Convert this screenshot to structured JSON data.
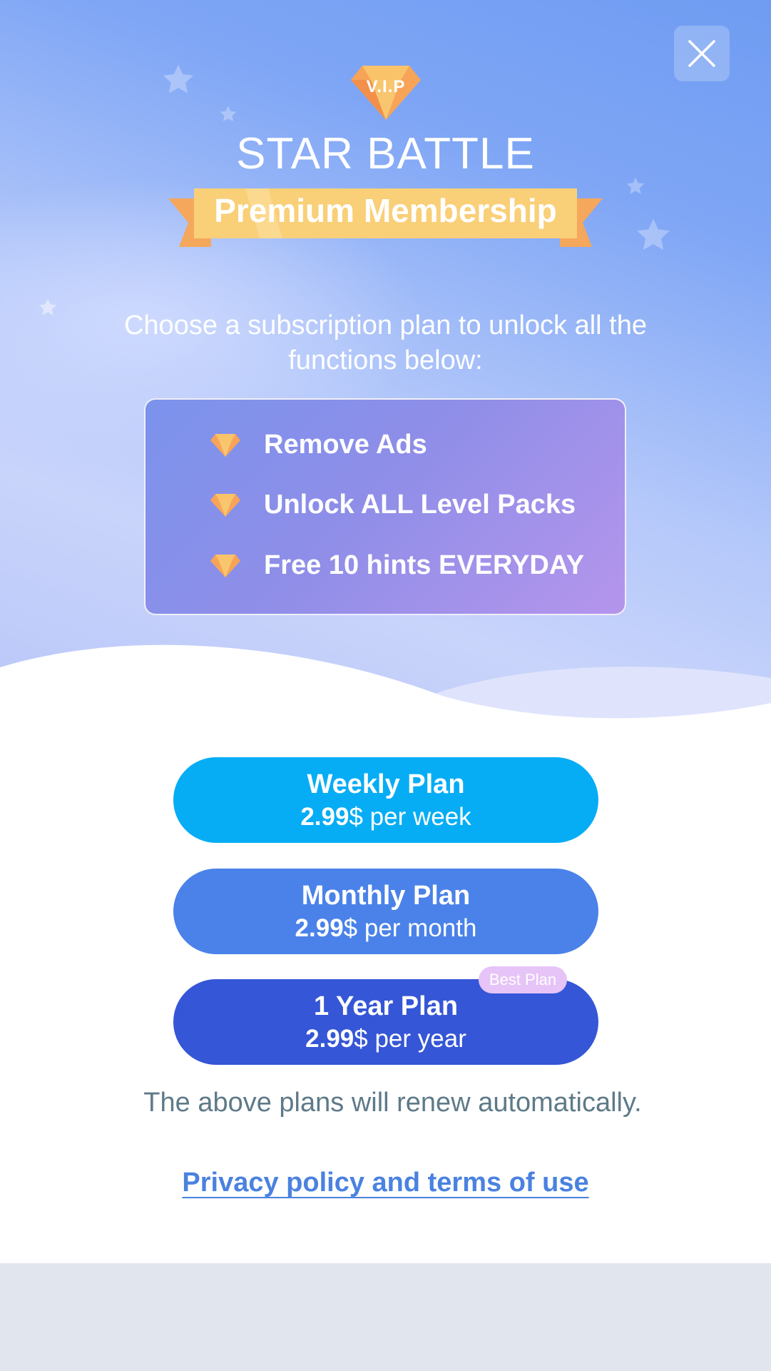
{
  "header": {
    "close_icon": "close-icon",
    "vip_label": "V.I.P",
    "title": "STAR BATTLE",
    "ribbon_label": "Premium Membership"
  },
  "intro": {
    "subtitle": "Choose a subscription plan to unlock all the functions below:"
  },
  "features": [
    {
      "icon": "diamond-icon",
      "label": "Remove Ads"
    },
    {
      "icon": "diamond-icon",
      "label": "Unlock ALL Level Packs"
    },
    {
      "icon": "diamond-icon",
      "label": "Free 10 hints EVERYDAY"
    }
  ],
  "plans": [
    {
      "name": "Weekly Plan",
      "price": "2.99",
      "period": "$ per week",
      "color": "#06adf5"
    },
    {
      "name": "Monthly Plan",
      "price": "2.99",
      "period": "$ per month",
      "color": "#4a82e9"
    },
    {
      "name": "1 Year Plan",
      "price": "2.99",
      "period": "$ per year",
      "color": "#3556d6",
      "badge": "Best Plan"
    }
  ],
  "footer": {
    "renew_note": "The above plans will renew automatically.",
    "privacy_link": "Privacy policy and terms of use"
  },
  "colors": {
    "hero_top": "#6f9cf2",
    "gold": "#f7c35e",
    "orange": "#f5a25d",
    "link": "#4a82e0"
  }
}
